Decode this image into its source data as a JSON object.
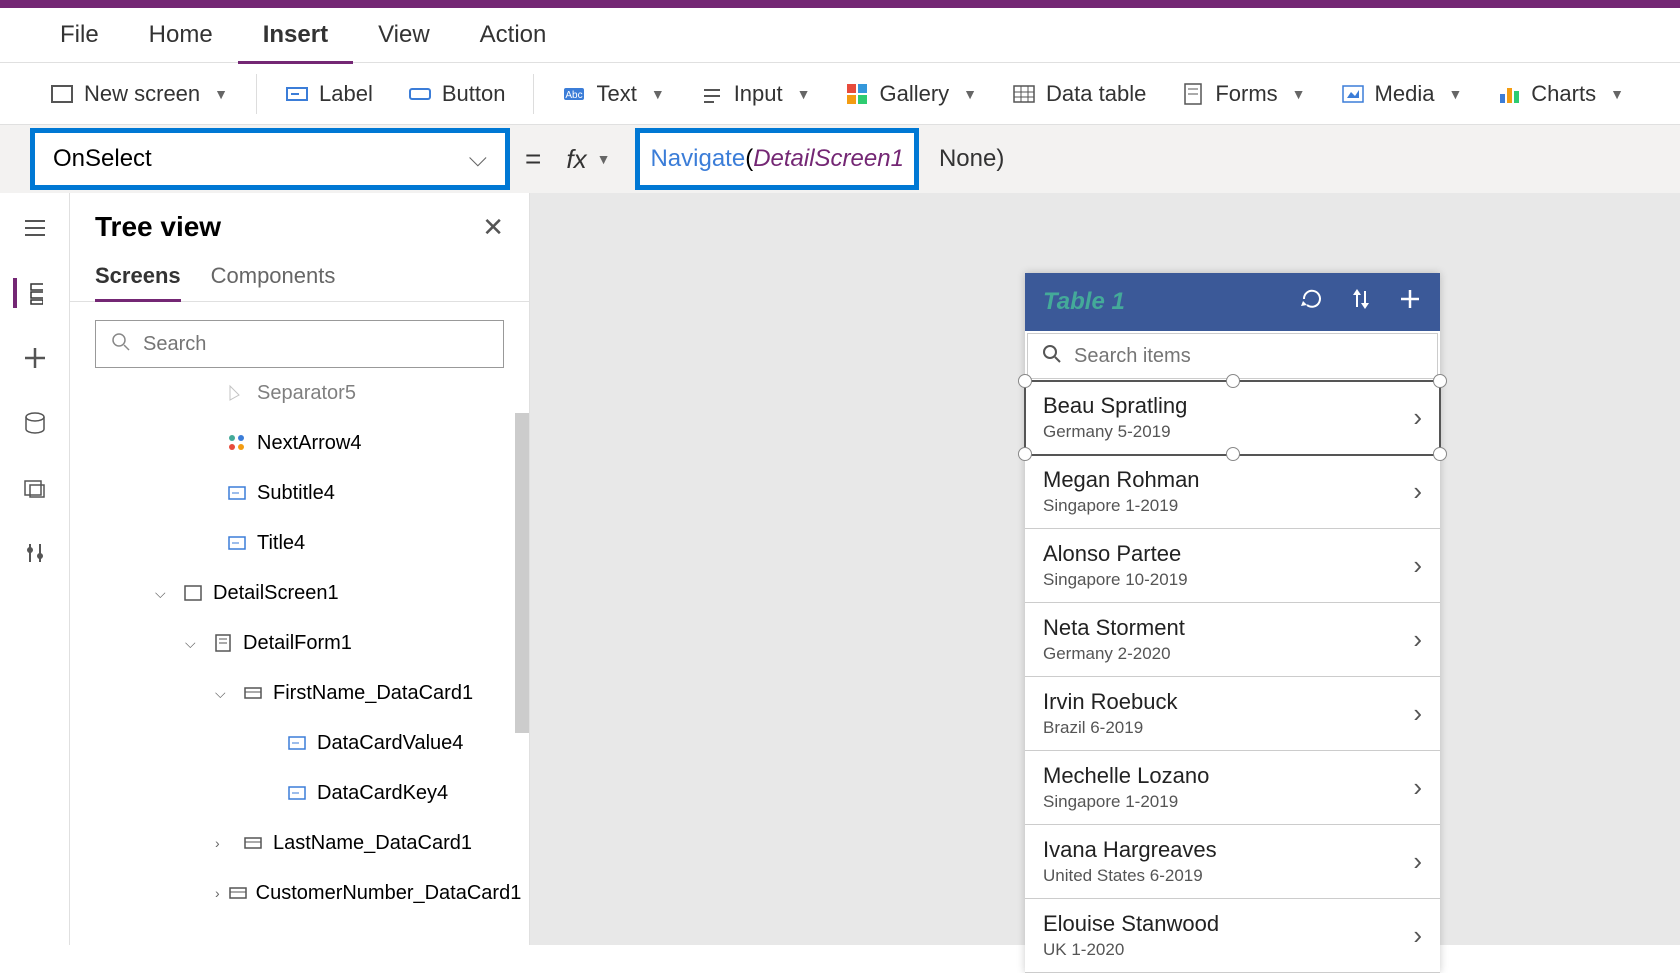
{
  "menu": {
    "file": "File",
    "home": "Home",
    "insert": "Insert",
    "view": "View",
    "action": "Action"
  },
  "toolbar": {
    "new_screen": "New screen",
    "label": "Label",
    "button": "Button",
    "text": "Text",
    "input": "Input",
    "gallery": "Gallery",
    "data_table": "Data table",
    "forms": "Forms",
    "media": "Media",
    "charts": "Charts"
  },
  "formula": {
    "property": "OnSelect",
    "equals": "=",
    "fx": "fx",
    "func": "Navigate",
    "open": "(",
    "param": "DetailScreen1",
    "rest": " None)"
  },
  "tree": {
    "title": "Tree view",
    "tab_screens": "Screens",
    "tab_components": "Components",
    "search_placeholder": "Search",
    "nodes": [
      {
        "label": "Separator5",
        "indent": 3,
        "icon": "separator"
      },
      {
        "label": "NextArrow4",
        "indent": 3,
        "icon": "arrow-group"
      },
      {
        "label": "Subtitle4",
        "indent": 3,
        "icon": "text"
      },
      {
        "label": "Title4",
        "indent": 3,
        "icon": "text"
      },
      {
        "label": "DetailScreen1",
        "indent": 1,
        "icon": "screen",
        "expanded": true
      },
      {
        "label": "DetailForm1",
        "indent": 2,
        "icon": "form",
        "expanded": true
      },
      {
        "label": "FirstName_DataCard1",
        "indent": 3,
        "icon": "card",
        "expanded": true
      },
      {
        "label": "DataCardValue4",
        "indent": 5,
        "icon": "text"
      },
      {
        "label": "DataCardKey4",
        "indent": 5,
        "icon": "text"
      },
      {
        "label": "LastName_DataCard1",
        "indent": 3,
        "icon": "card",
        "collapsed": true
      },
      {
        "label": "CustomerNumber_DataCard1",
        "indent": 3,
        "icon": "card",
        "collapsed": true
      }
    ]
  },
  "preview": {
    "header_title": "Table 1",
    "search_placeholder": "Search items",
    "items": [
      {
        "name": "Beau Spratling",
        "sub": "Germany 5-2019",
        "selected": true
      },
      {
        "name": "Megan Rohman",
        "sub": "Singapore 1-2019"
      },
      {
        "name": "Alonso Partee",
        "sub": "Singapore 10-2019"
      },
      {
        "name": "Neta Storment",
        "sub": "Germany 2-2020"
      },
      {
        "name": "Irvin Roebuck",
        "sub": "Brazil 6-2019"
      },
      {
        "name": "Mechelle Lozano",
        "sub": "Singapore 1-2019"
      },
      {
        "name": "Ivana Hargreaves",
        "sub": "United States 6-2019"
      },
      {
        "name": "Elouise Stanwood",
        "sub": "UK 1-2020"
      }
    ]
  }
}
